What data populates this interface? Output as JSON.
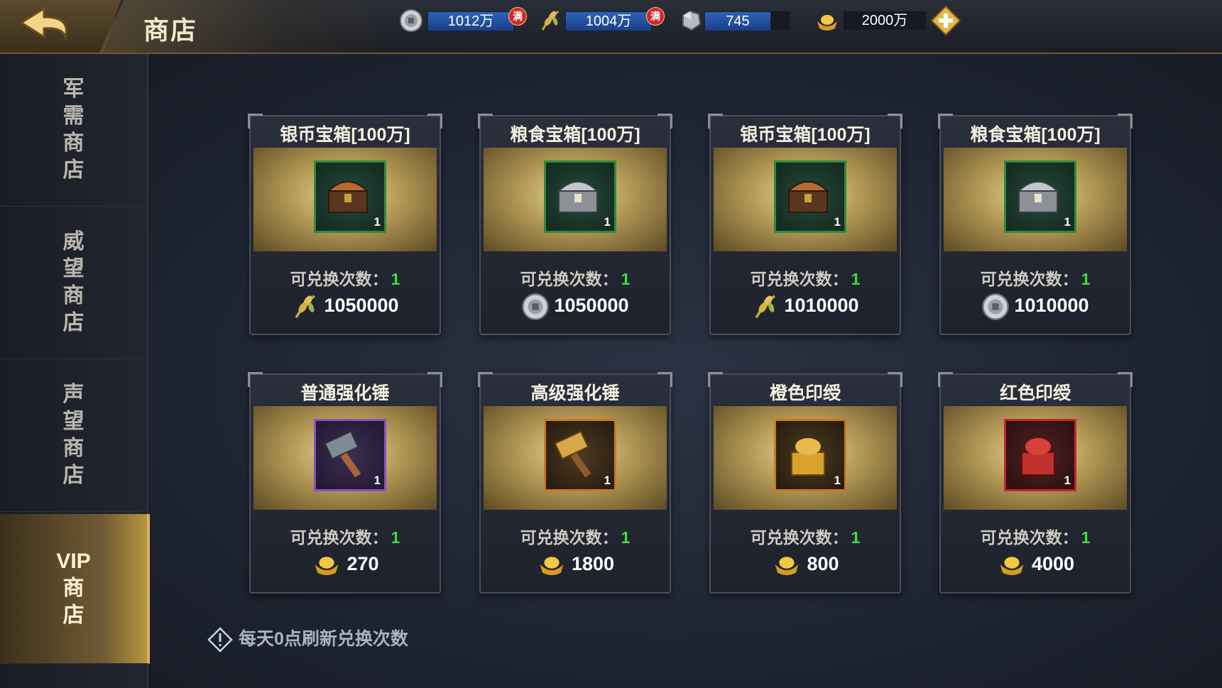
{
  "header": {
    "title": "商店",
    "back_icon": "back-arrow-icon"
  },
  "resources": {
    "silver": {
      "icon": "silver-coin-icon",
      "value": "1012万",
      "cap": "满"
    },
    "grain": {
      "icon": "grain-icon",
      "value": "1004万",
      "cap": "满"
    },
    "iron": {
      "icon": "iron-ore-icon",
      "value": "745"
    },
    "gold": {
      "icon": "gold-ingot-icon",
      "value": "2000万",
      "add_icon": "plus-icon"
    }
  },
  "sidebar": {
    "items": [
      {
        "label": "军\n需\n商\n店",
        "active": false
      },
      {
        "label": "威\n望\n商\n店",
        "active": false
      },
      {
        "label": "声\n望\n商\n店",
        "active": false
      },
      {
        "label": "VIP\n商\n店",
        "active": true
      }
    ]
  },
  "cards": [
    {
      "name": "银币宝箱[100万]",
      "icon": "treasure-chest-icon",
      "slot": "green",
      "qty": "1",
      "limit_label": "可兑换次数：",
      "limit": "1",
      "cost_icon": "grain-icon",
      "cost": "1050000"
    },
    {
      "name": "粮食宝箱[100万]",
      "icon": "silver-chest-icon",
      "slot": "green",
      "qty": "1",
      "limit_label": "可兑换次数：",
      "limit": "1",
      "cost_icon": "silver-coin-icon",
      "cost": "1050000"
    },
    {
      "name": "银币宝箱[100万]",
      "icon": "treasure-chest-icon",
      "slot": "green",
      "qty": "1",
      "limit_label": "可兑换次数：",
      "limit": "1",
      "cost_icon": "grain-icon",
      "cost": "1010000"
    },
    {
      "name": "粮食宝箱[100万]",
      "icon": "silver-chest-icon",
      "slot": "green",
      "qty": "1",
      "limit_label": "可兑换次数：",
      "limit": "1",
      "cost_icon": "silver-coin-icon",
      "cost": "1010000"
    },
    {
      "name": "普通强化锤",
      "icon": "iron-hammer-icon",
      "slot": "purple",
      "qty": "1",
      "limit_label": "可兑换次数：",
      "limit": "1",
      "cost_icon": "gold-ingot-icon",
      "cost": "270"
    },
    {
      "name": "高级强化锤",
      "icon": "gold-hammer-icon",
      "slot": "orange",
      "qty": "1",
      "limit_label": "可兑换次数：",
      "limit": "1",
      "cost_icon": "gold-ingot-icon",
      "cost": "1800"
    },
    {
      "name": "橙色印绶",
      "icon": "orange-seal-icon",
      "slot": "orange",
      "qty": "1",
      "limit_label": "可兑换次数：",
      "limit": "1",
      "cost_icon": "gold-ingot-icon",
      "cost": "800"
    },
    {
      "name": "红色印绶",
      "icon": "red-seal-icon",
      "slot": "red",
      "qty": "1",
      "limit_label": "可兑换次数：",
      "limit": "1",
      "cost_icon": "gold-ingot-icon",
      "cost": "4000"
    }
  ],
  "footer": {
    "note": "每天0点刷新兑换次数",
    "icon": "warning-diamond-icon"
  },
  "colors": {
    "accent_gold": "#d8b35a",
    "count_green": "#3fdc43",
    "resource_blue": "#2d63b8",
    "cap_red": "#d2272b"
  }
}
